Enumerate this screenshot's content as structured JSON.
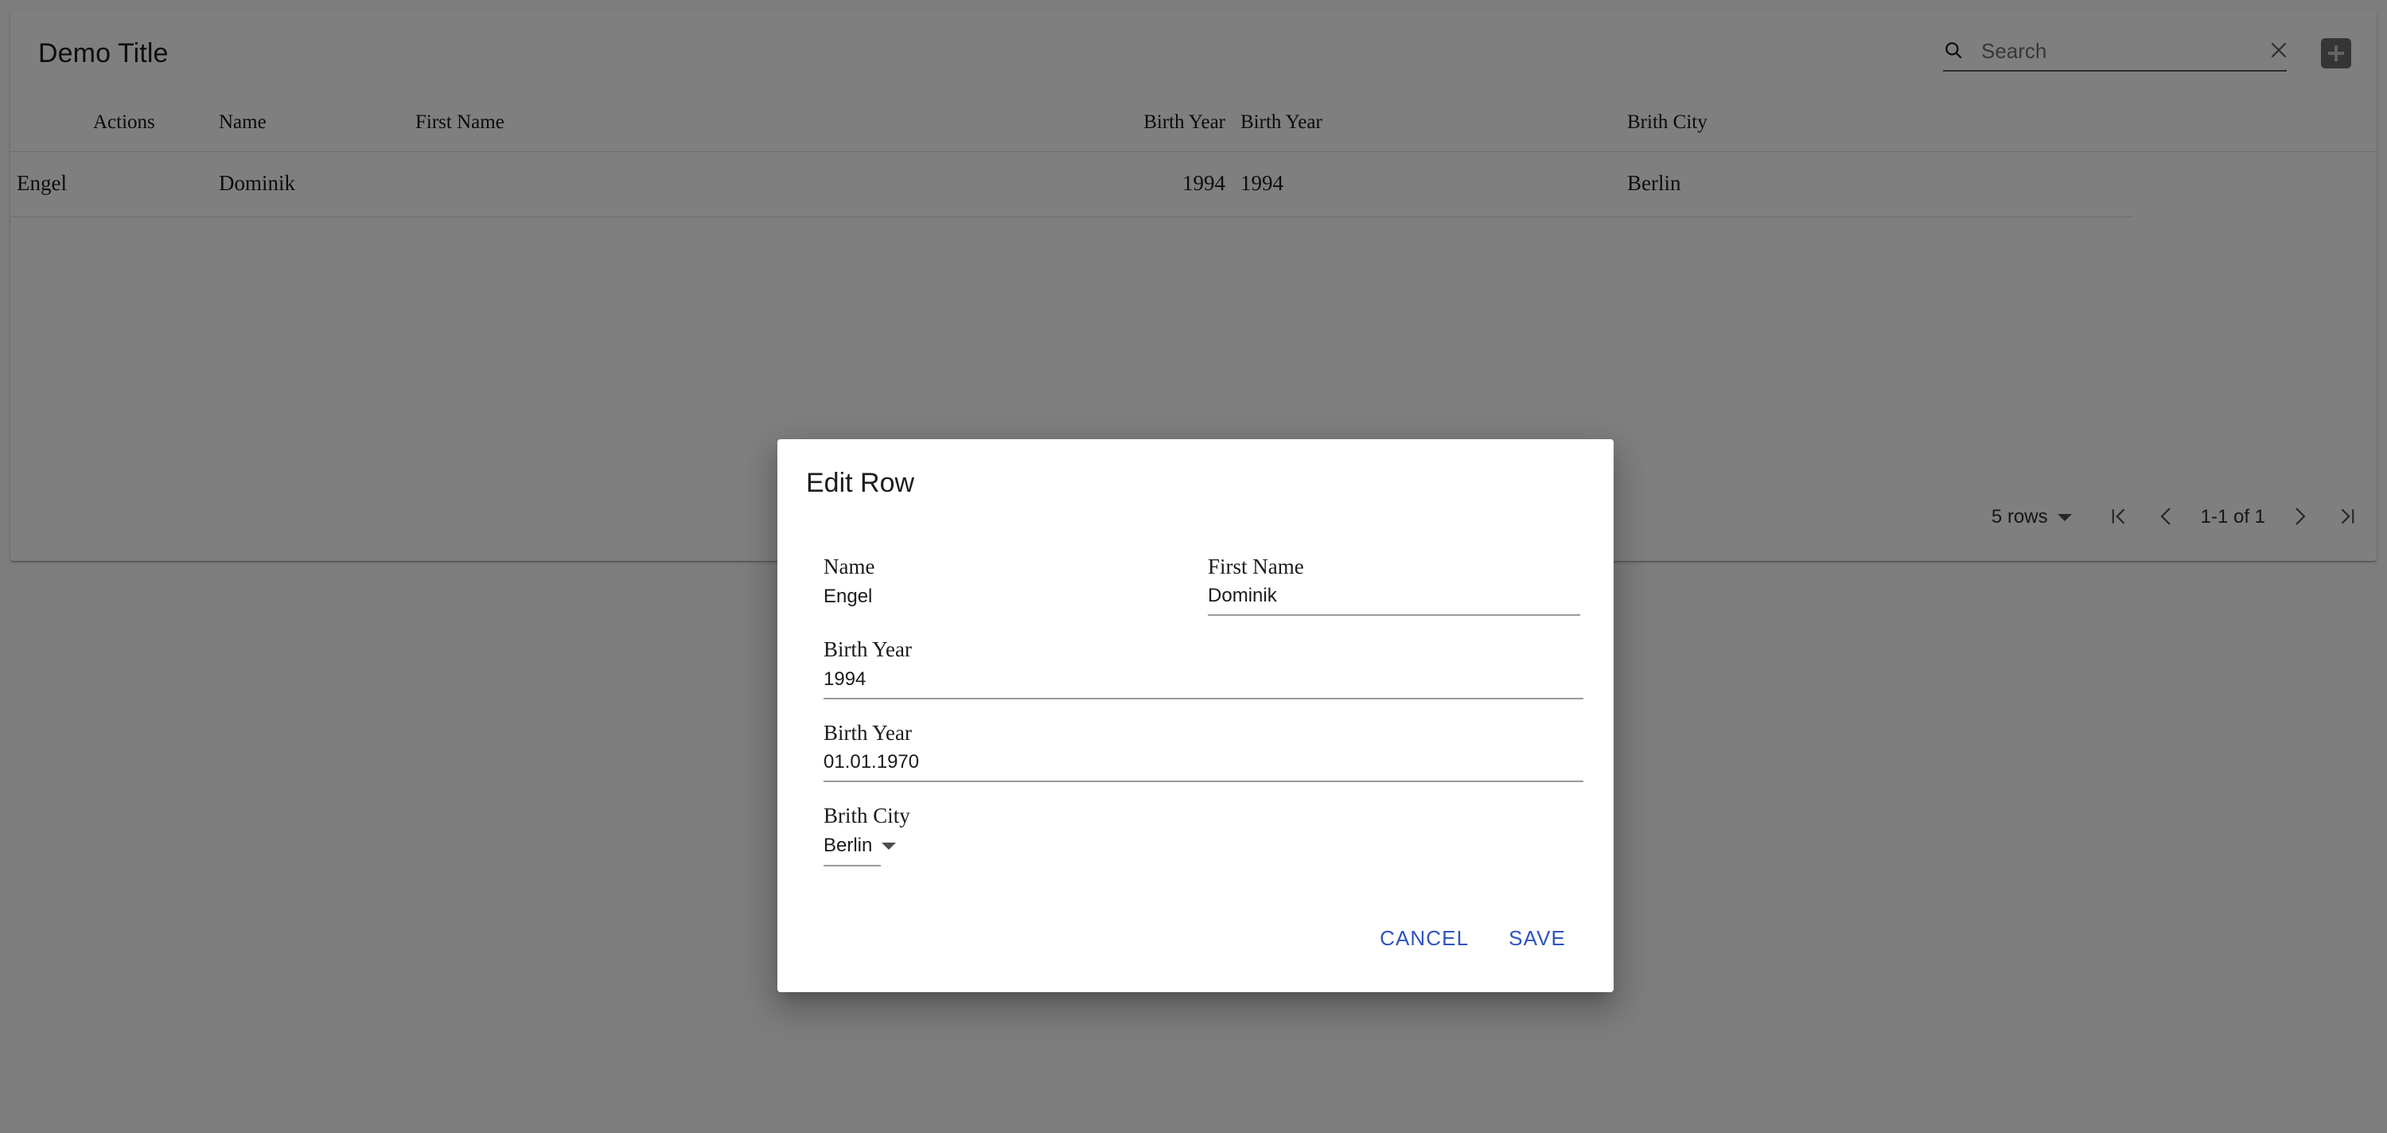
{
  "toolbar": {
    "title": "Demo Title",
    "search_placeholder": "Search",
    "search_value": "",
    "search_icon": "search-icon",
    "clear_icon": "close-icon",
    "add_icon": "plus-icon"
  },
  "table": {
    "columns": [
      {
        "label": "Actions"
      },
      {
        "label": "Name"
      },
      {
        "label": "First Name"
      },
      {
        "label": "Birth Year"
      },
      {
        "label": "Birth Year"
      },
      {
        "label": "Brith City"
      },
      {
        "label": ""
      }
    ],
    "rows": [
      {
        "actions": "Engel",
        "name": "Dominik",
        "first_name": "",
        "birth_year_1": "1994",
        "birth_year_2": "1994",
        "brith_city": "Berlin",
        "tail": ""
      }
    ]
  },
  "paginator": {
    "rows_per_page": "5 rows",
    "first_page_icon": "first-page-icon",
    "prev_page_icon": "chevron-left-icon",
    "range": "1-1 of 1",
    "next_page_icon": "chevron-right-icon",
    "last_page_icon": "last-page-icon"
  },
  "modal": {
    "title": "Edit Row",
    "fields": {
      "name": {
        "label": "Name",
        "value": "Engel"
      },
      "first_name": {
        "label": "First Name",
        "value": "Dominik"
      },
      "birth_year_1": {
        "label": "Birth Year",
        "value": "1994"
      },
      "birth_year_2": {
        "label": "Birth Year",
        "value": "01.01.1970"
      },
      "brith_city": {
        "label": "Brith City",
        "value": "Berlin"
      }
    },
    "cancel_label": "CANCEL",
    "save_label": "SAVE",
    "accent_color": "#2f53c0"
  }
}
